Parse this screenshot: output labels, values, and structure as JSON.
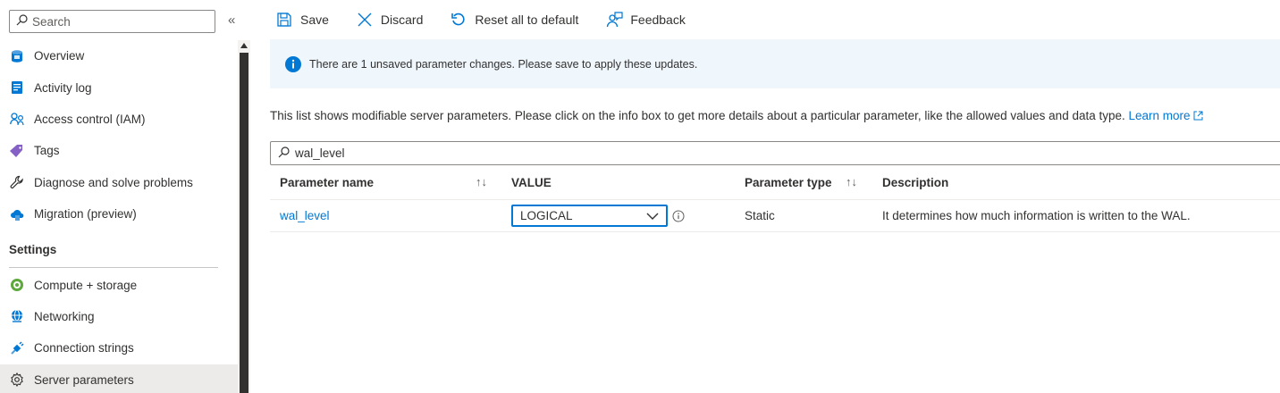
{
  "sidebar": {
    "search_placeholder": "Search",
    "collapse_glyph": "«",
    "items": [
      {
        "label": "Overview",
        "icon": "database-icon"
      },
      {
        "label": "Activity log",
        "icon": "activity-log-icon"
      },
      {
        "label": "Access control (IAM)",
        "icon": "people-icon"
      },
      {
        "label": "Tags",
        "icon": "tag-icon"
      },
      {
        "label": "Diagnose and solve problems",
        "icon": "wrench-icon"
      },
      {
        "label": "Migration (preview)",
        "icon": "cloud-migration-icon"
      }
    ],
    "section_heading": "Settings",
    "settings_items": [
      {
        "label": "Compute + storage",
        "icon": "compute-icon"
      },
      {
        "label": "Networking",
        "icon": "globe-network-icon"
      },
      {
        "label": "Connection strings",
        "icon": "plug-icon"
      },
      {
        "label": "Server parameters",
        "icon": "gear-icon",
        "active": true
      }
    ]
  },
  "toolbar": {
    "save_label": "Save",
    "discard_label": "Discard",
    "reset_label": "Reset all to default",
    "feedback_label": "Feedback"
  },
  "banner": {
    "message": "There are 1 unsaved parameter changes.  Please save to apply these updates."
  },
  "description": {
    "text": "This list shows modifiable server parameters. Please click on the info box to get more details about a particular parameter, like the allowed values and data type.",
    "link_label": "Learn more"
  },
  "filter": {
    "value": "wal_level"
  },
  "table": {
    "headers": {
      "name": "Parameter name",
      "value": "VALUE",
      "type": "Parameter type",
      "description": "Description"
    },
    "rows": [
      {
        "name": "wal_level",
        "value": "LOGICAL",
        "type": "Static",
        "description": "It determines how much information is written to the WAL."
      }
    ]
  },
  "colors": {
    "accent": "#0078d4",
    "banner_bg": "#eff6fc",
    "active_bg": "#edebe9"
  }
}
